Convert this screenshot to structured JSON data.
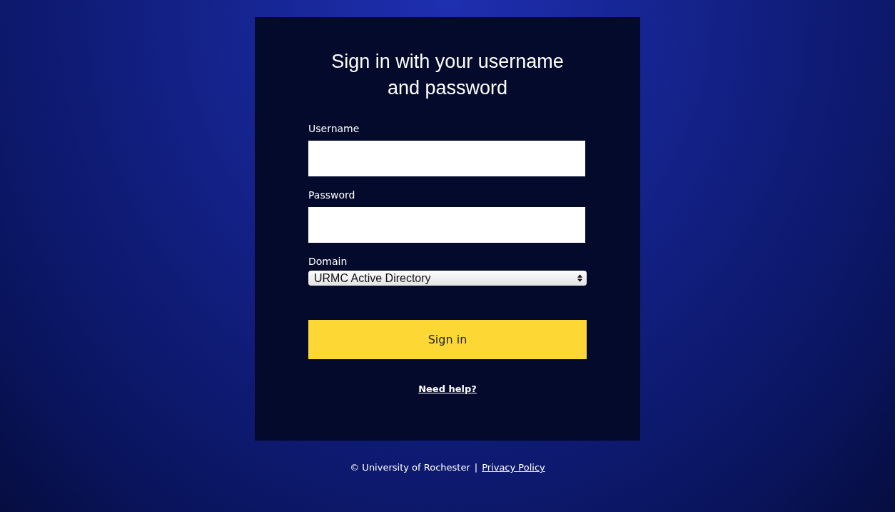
{
  "title": "Sign in with your username and password",
  "fields": [
    {
      "label": "Username"
    },
    {
      "label": "Password"
    }
  ],
  "domain": {
    "label": "Domain",
    "value": "URMC Active Directory"
  },
  "button": "Sign in",
  "help_link": "Need help?",
  "footer": {
    "copyright": "© University of Rochester",
    "separator": "|",
    "link": "Privacy Policy"
  }
}
